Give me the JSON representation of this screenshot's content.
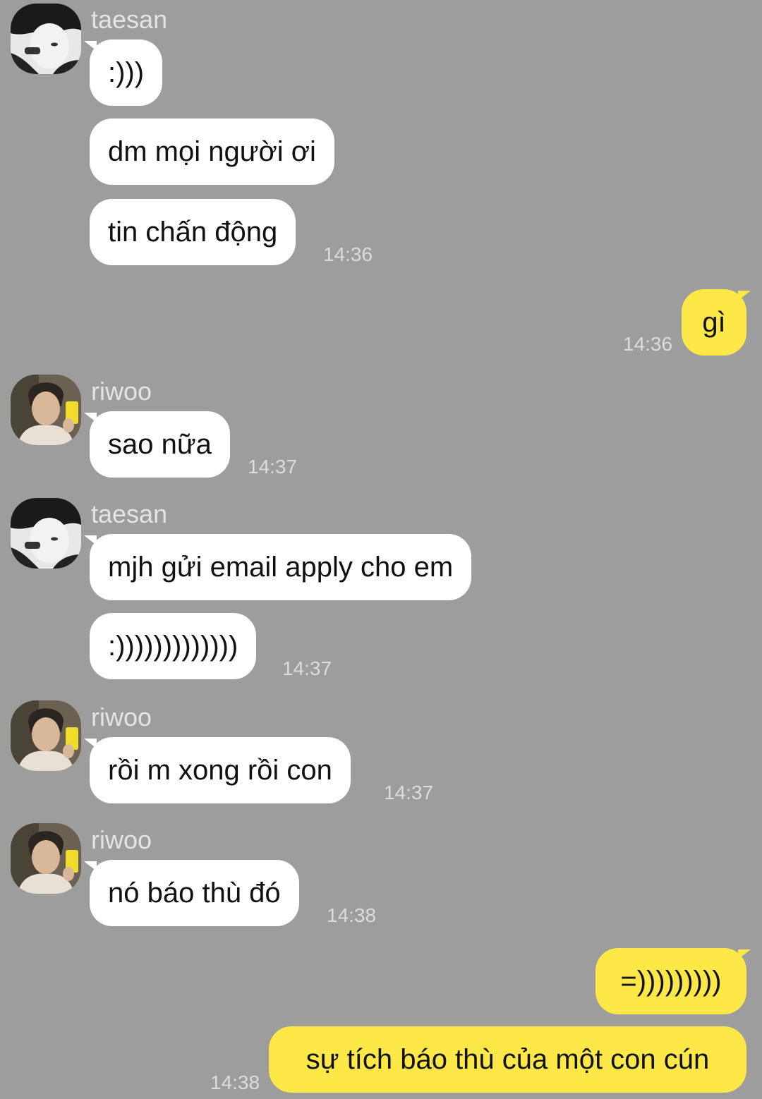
{
  "colors": {
    "background": "#9d9d9d",
    "incoming_bubble": "#ffffff",
    "outgoing_bubble": "#fde848",
    "name_text": "#e4e4e4",
    "time_text": "#dcdcdc"
  },
  "groups": [
    {
      "sender": "taesan",
      "avatar_icon": "taesan-avatar",
      "messages": [
        ":)))",
        "dm mọi người ơi",
        "tin chấn động"
      ],
      "time": "14:36"
    },
    {
      "sender": "me",
      "messages": [
        "gì"
      ],
      "time": "14:36"
    },
    {
      "sender": "riwoo",
      "avatar_icon": "riwoo-avatar",
      "messages": [
        "sao nữa"
      ],
      "time": "14:37"
    },
    {
      "sender": "taesan",
      "avatar_icon": "taesan-avatar",
      "messages": [
        "mjh gửi email apply cho em",
        ":)))))))))))))"
      ],
      "time": "14:37"
    },
    {
      "sender": "riwoo",
      "avatar_icon": "riwoo-avatar",
      "messages": [
        "rồi m xong rồi con"
      ],
      "time": "14:37"
    },
    {
      "sender": "riwoo",
      "avatar_icon": "riwoo-avatar",
      "messages": [
        "nó báo thù đó"
      ],
      "time": "14:38"
    },
    {
      "sender": "me",
      "messages": [
        "=)))))))))",
        "sự tích báo thù của một con cún"
      ],
      "time": "14:38"
    }
  ]
}
